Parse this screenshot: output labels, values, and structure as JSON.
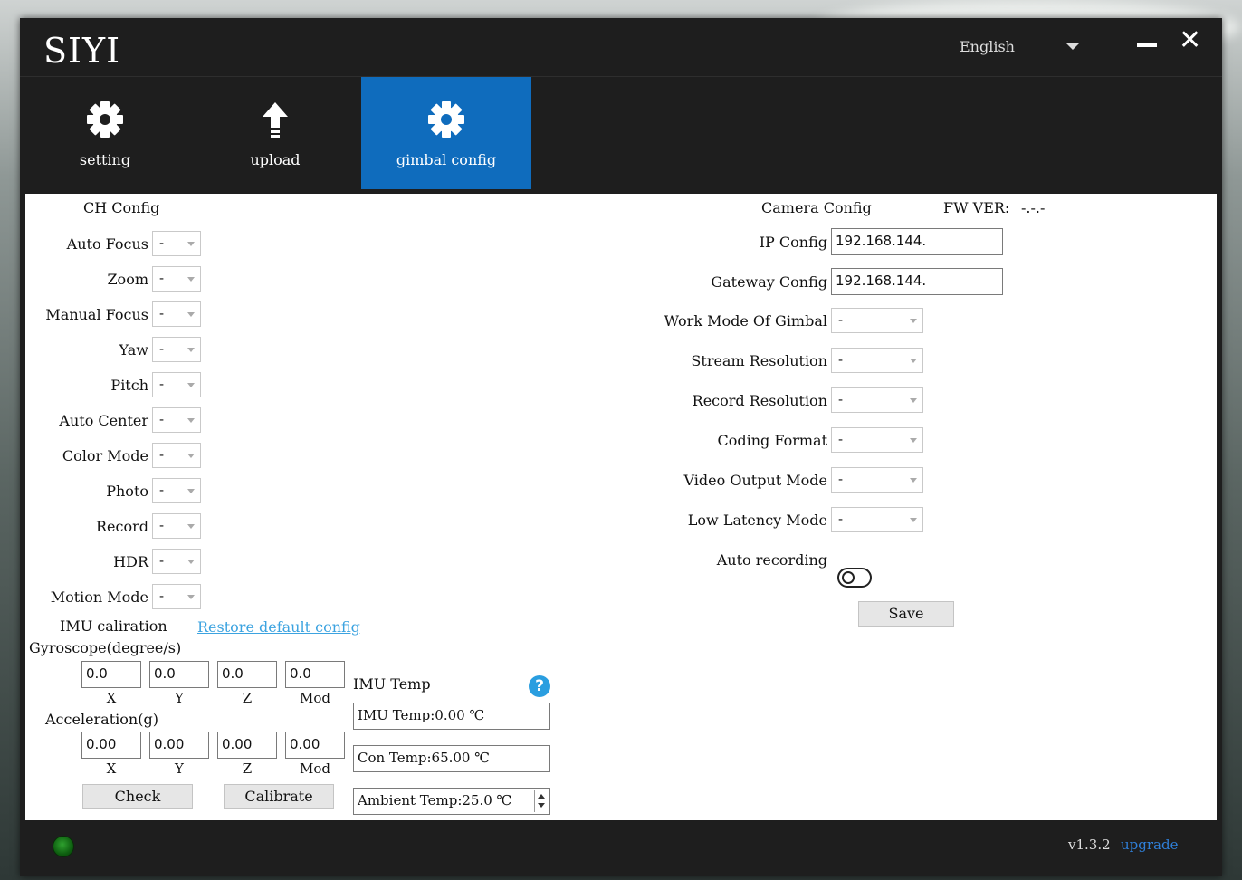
{
  "app": {
    "logo": "SIYI",
    "language": "English"
  },
  "nav": {
    "tabs": [
      {
        "label": "setting",
        "icon": "gear-icon"
      },
      {
        "label": "upload",
        "icon": "upload-arrow-icon"
      },
      {
        "label": "gimbal config",
        "icon": "gear-icon",
        "active": true
      }
    ]
  },
  "ch_config": {
    "title": "CH Config",
    "rows": [
      {
        "label": "Auto Focus",
        "value": "-"
      },
      {
        "label": "Zoom",
        "value": "-"
      },
      {
        "label": "Manual Focus",
        "value": "-"
      },
      {
        "label": "Yaw",
        "value": "-"
      },
      {
        "label": "Pitch",
        "value": "-"
      },
      {
        "label": "Auto Center",
        "value": "-"
      },
      {
        "label": "Color Mode",
        "value": "-"
      },
      {
        "label": "Photo",
        "value": "-"
      },
      {
        "label": "Record",
        "value": "-"
      },
      {
        "label": "HDR",
        "value": "-"
      },
      {
        "label": "Motion Mode",
        "value": "-"
      }
    ]
  },
  "imu": {
    "calibration_label": "IMU caliration",
    "restore_link": "Restore default config",
    "gyro_label": "Gyroscope(degree/s)",
    "gyro": [
      "0.0",
      "0.0",
      "0.0",
      "0.0"
    ],
    "accel_label": "Acceleration(g)",
    "accel": [
      "0.00",
      "0.00",
      "0.00",
      "0.00"
    ],
    "axes": [
      "X",
      "Y",
      "Z",
      "Mod"
    ],
    "check_label": "Check",
    "calibrate_label": "Calibrate",
    "temp_title": "IMU Temp",
    "imu_temp": "IMU Temp:0.00 ℃",
    "con_temp": "Con Temp:65.00 ℃",
    "ambient_temp": "Ambient Temp:25.0 ℃"
  },
  "camera_config": {
    "title": "Camera Config",
    "fw_label": "FW VER:",
    "fw_value": "-.-.-",
    "ip_label": "IP Config",
    "ip_value": "192.168.144.",
    "gateway_label": "Gateway Config",
    "gateway_value": "192.168.144.",
    "selects": [
      {
        "label": "Work Mode Of Gimbal",
        "value": "-"
      },
      {
        "label": "Stream Resolution",
        "value": "-"
      },
      {
        "label": "Record Resolution",
        "value": "-"
      },
      {
        "label": "Coding Format",
        "value": "-"
      },
      {
        "label": "Video Output Mode",
        "value": "-"
      },
      {
        "label": "Low Latency Mode",
        "value": "-"
      }
    ],
    "auto_recording_label": "Auto recording",
    "auto_recording_on": false,
    "save_label": "Save"
  },
  "footer": {
    "version": "v1.3.2",
    "upgrade_label": "upgrade"
  }
}
